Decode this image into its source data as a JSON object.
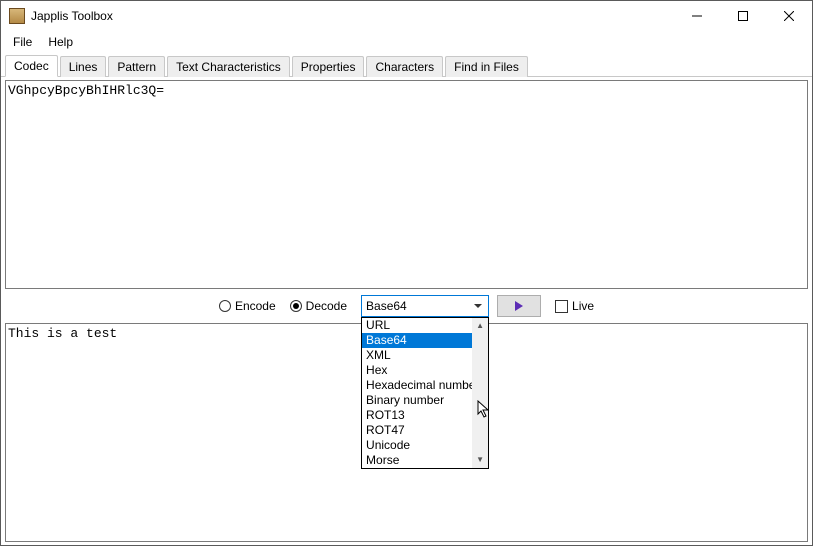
{
  "window": {
    "title": "Japplis Toolbox"
  },
  "menubar": {
    "file": "File",
    "help": "Help"
  },
  "tabs": [
    {
      "label": "Codec",
      "active": true
    },
    {
      "label": "Lines"
    },
    {
      "label": "Pattern"
    },
    {
      "label": "Text Characteristics"
    },
    {
      "label": "Properties"
    },
    {
      "label": "Characters"
    },
    {
      "label": "Find in Files"
    }
  ],
  "input_text": "VGhpcyBpcyBhIHRlc3Q=",
  "output_text": "This is a test",
  "controls": {
    "encode_label": "Encode",
    "decode_label": "Decode",
    "selected_mode": "decode",
    "combo_selected": "Base64",
    "live_label": "Live",
    "live_checked": false
  },
  "dropdown_options": [
    {
      "label": "URL"
    },
    {
      "label": "Base64",
      "highlight": true
    },
    {
      "label": "XML"
    },
    {
      "label": "Hex"
    },
    {
      "label": "Hexadecimal number"
    },
    {
      "label": "Binary number"
    },
    {
      "label": "ROT13"
    },
    {
      "label": "ROT47"
    },
    {
      "label": "Unicode"
    },
    {
      "label": "Morse"
    }
  ]
}
